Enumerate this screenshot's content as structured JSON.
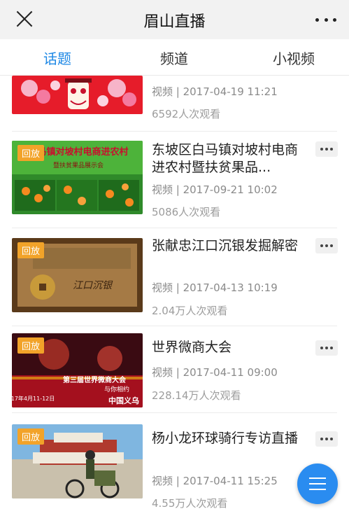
{
  "header": {
    "title": "眉山直播"
  },
  "tabs": [
    {
      "label": "话题",
      "active": true
    },
    {
      "label": "频道",
      "active": false
    },
    {
      "label": "小视频",
      "active": false
    }
  ],
  "items": [
    {
      "title": "",
      "meta": "视频 | 2017-04-19 11:21",
      "views": "6592人次观看",
      "thumb_text": ""
    },
    {
      "title": "东坡区白马镇对坡村电商进农村暨扶贫果品...",
      "meta": "视频 | 2017-09-21 10:02",
      "views": "5086人次观看",
      "badge": "回放",
      "thumb_text": "白马镇对坡村电商进农村",
      "thumb_subtext": "暨扶贫果品展示会"
    },
    {
      "title": "张献忠江口沉银发掘解密",
      "meta": "视频 | 2017-04-13 10:19",
      "views": "2.04万人次观看",
      "badge": "回放",
      "thumb_text": "江口沉银"
    },
    {
      "title": "世界微商大会",
      "meta": "视频 | 2017-04-11 09:00",
      "views": "228.14万人次观看",
      "badge": "回放",
      "thumb_text": "第三届世界微商大会",
      "thumb_subtext": "与你相约",
      "thumb_date": "17年4月11-12日",
      "thumb_place": "中国义乌"
    },
    {
      "title": "杨小龙环球骑行专访直播",
      "meta": "视频 | 2017-04-11 15:25",
      "views": "4.55万人次观看",
      "badge": "回放",
      "thumb_text": ""
    }
  ],
  "colors": {
    "accent": "#1e88e5",
    "badge": "#f2a329",
    "fab": "#2a8cf0"
  },
  "icons": {
    "close": "close-icon",
    "more": "more-dots-icon",
    "item_menu": "ellipsis-icon",
    "fab": "menu-lines-icon"
  }
}
